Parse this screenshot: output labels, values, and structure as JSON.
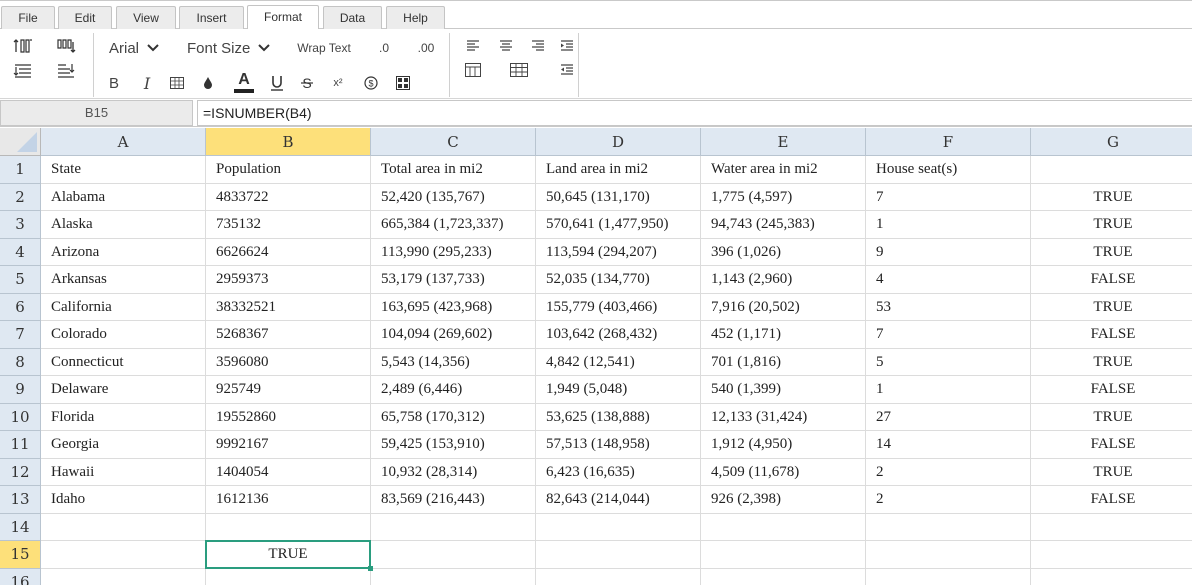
{
  "menu": {
    "tabs": [
      {
        "label": "File",
        "active": false
      },
      {
        "label": "Edit",
        "active": false
      },
      {
        "label": "View",
        "active": false
      },
      {
        "label": "Insert",
        "active": false
      },
      {
        "label": "Format",
        "active": true
      },
      {
        "label": "Data",
        "active": false
      },
      {
        "label": "Help",
        "active": false
      }
    ]
  },
  "toolbar": {
    "font_name": "Arial",
    "font_size": "Font Size",
    "wrap_text": "Wrap Text",
    "decrease_decimal": ".0",
    "increase_decimal": ".00",
    "bold": "B",
    "italic": "I",
    "superscript": "x²",
    "currency": "$"
  },
  "formula_bar": {
    "cell_ref": "B15",
    "formula": "=ISNUMBER(B4)"
  },
  "sheet": {
    "columns": [
      "A",
      "B",
      "C",
      "D",
      "E",
      "F",
      "G"
    ],
    "selected_column": "B",
    "selected_row": "15",
    "row_numbers": [
      "1",
      "2",
      "3",
      "4",
      "5",
      "6",
      "7",
      "8",
      "9",
      "10",
      "11",
      "12",
      "13",
      "14",
      "15",
      "16"
    ],
    "rows": [
      [
        "State",
        "Population",
        "Total area in mi2",
        "Land area in mi2",
        "Water area in mi2",
        "House seat(s)",
        ""
      ],
      [
        "Alabama",
        "4833722",
        "52,420 (135,767)",
        "50,645 (131,170)",
        "1,775 (4,597)",
        "7",
        "TRUE"
      ],
      [
        "Alaska",
        "735132",
        "665,384 (1,723,337)",
        "570,641 (1,477,950)",
        "94,743 (245,383)",
        "1",
        "TRUE"
      ],
      [
        "Arizona",
        "6626624",
        "113,990 (295,233)",
        "113,594 (294,207)",
        "396 (1,026)",
        "9",
        "TRUE"
      ],
      [
        "Arkansas",
        "2959373",
        "53,179 (137,733)",
        "52,035 (134,770)",
        "1,143 (2,960)",
        "4",
        "FALSE"
      ],
      [
        "California",
        "38332521",
        "163,695 (423,968)",
        "155,779 (403,466)",
        "7,916 (20,502)",
        "53",
        "TRUE"
      ],
      [
        "Colorado",
        "5268367",
        "104,094 (269,602)",
        "103,642 (268,432)",
        "452 (1,171)",
        "7",
        "FALSE"
      ],
      [
        "Connecticut",
        "3596080",
        "5,543 (14,356)",
        "4,842 (12,541)",
        "701 (1,816)",
        "5",
        "TRUE"
      ],
      [
        "Delaware",
        "925749",
        "2,489 (6,446)",
        "1,949 (5,048)",
        "540 (1,399)",
        "1",
        "FALSE"
      ],
      [
        "Florida",
        "19552860",
        "65,758 (170,312)",
        "53,625 (138,888)",
        "12,133 (31,424)",
        "27",
        "TRUE"
      ],
      [
        "Georgia",
        "9992167",
        "59,425 (153,910)",
        "57,513 (148,958)",
        "1,912 (4,950)",
        "14",
        "FALSE"
      ],
      [
        "Hawaii",
        "1404054",
        "10,932 (28,314)",
        "6,423 (16,635)",
        "4,509 (11,678)",
        "2",
        "TRUE"
      ],
      [
        "Idaho",
        "1612136",
        "83,569 (216,443)",
        "82,643 (214,044)",
        "926 (2,398)",
        "2",
        "FALSE"
      ],
      [
        "",
        "",
        "",
        "",
        "",
        "",
        ""
      ],
      [
        "",
        "TRUE",
        "",
        "",
        "",
        "",
        ""
      ],
      [
        "",
        "",
        "",
        "",
        "",
        "",
        ""
      ]
    ]
  },
  "colors": {
    "header_bg": "#dfe8f2",
    "selected_header_bg": "#fde07a",
    "active_cell_border": "#2a9d7f"
  }
}
